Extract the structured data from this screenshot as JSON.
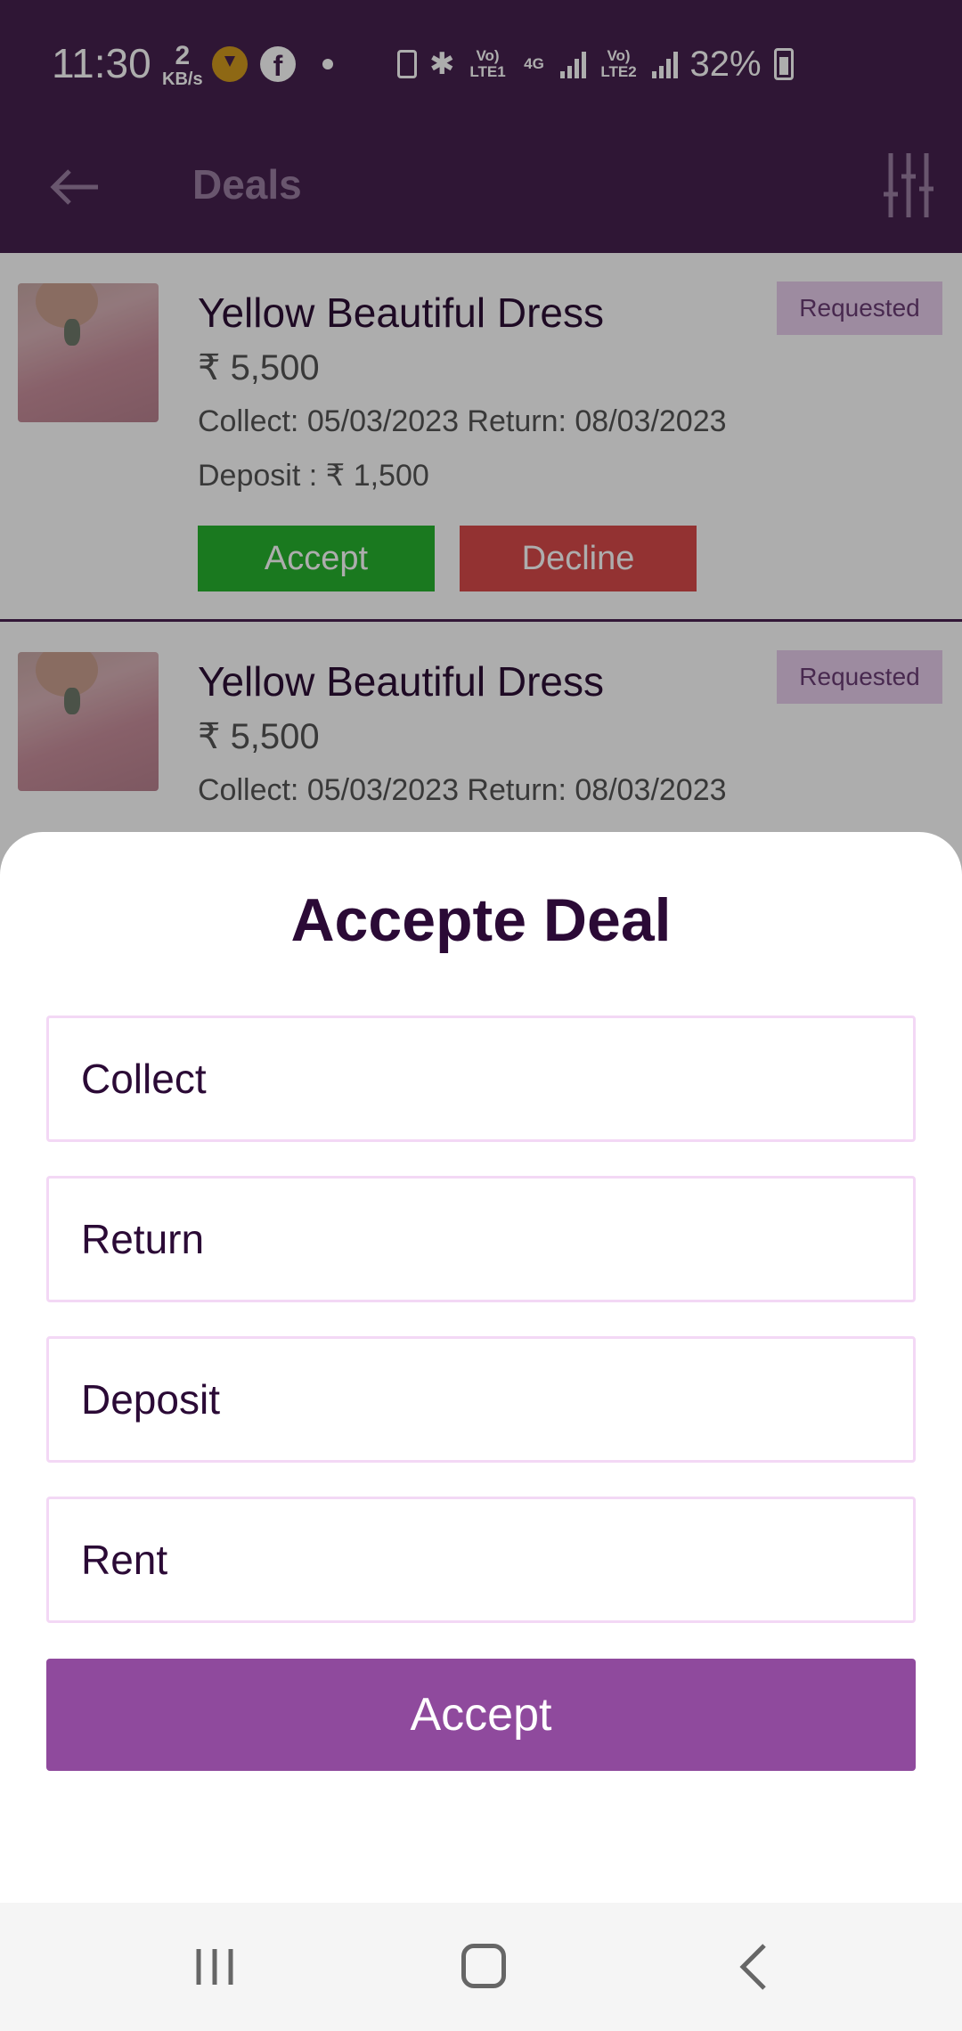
{
  "status_bar": {
    "time": "11:30",
    "net_speed_value": "2",
    "net_speed_unit": "KB/s",
    "lte1": "Vo) LTE1",
    "net_4g": "4G",
    "lte2": "Vo) LTE2",
    "battery": "32%"
  },
  "app_bar": {
    "title": "Deals"
  },
  "deals": [
    {
      "title": "Yellow Beautiful Dress",
      "price": "₹ 5,500",
      "dates": "Collect: 05/03/2023  Return: 08/03/2023",
      "deposit": "Deposit : ₹ 1,500",
      "status": "Requested",
      "accept_label": "Accept",
      "decline_label": "Decline"
    },
    {
      "title": "Yellow Beautiful Dress",
      "price": "₹ 5,500",
      "dates": "Collect: 05/03/2023  Return: 08/03/2023",
      "status": "Requested"
    }
  ],
  "sheet": {
    "title": "Accepte Deal",
    "fields": {
      "collect": "Collect",
      "return": "Return",
      "deposit": "Deposit",
      "rent": "Rent"
    },
    "accept_label": "Accept"
  },
  "colors": {
    "header": "#46214e",
    "accept_green": "#27b32e",
    "decline_red": "#d94b4b",
    "primary_purple": "#8f4a9d",
    "title_dark": "#2b0a36"
  }
}
